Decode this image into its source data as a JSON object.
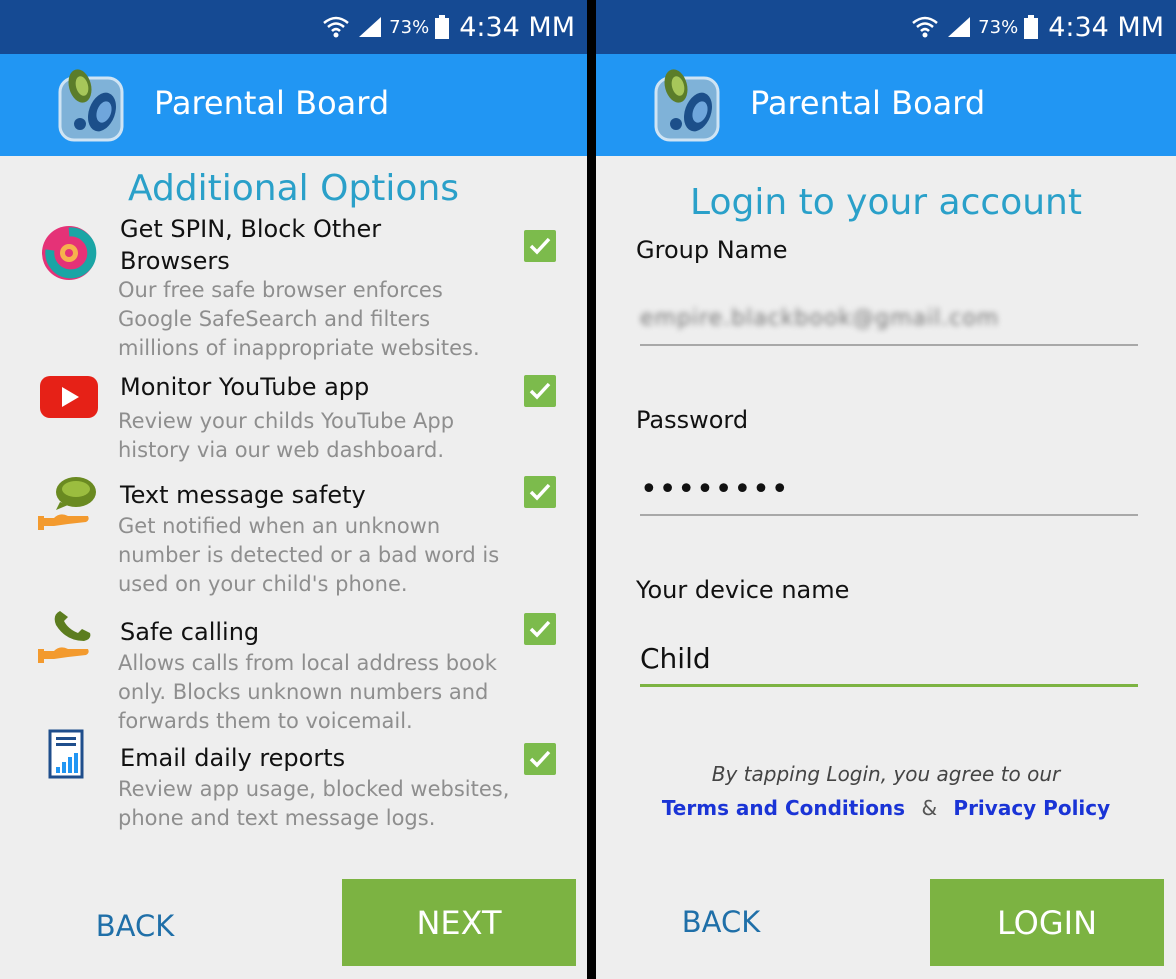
{
  "status_bar": {
    "battery": "73%",
    "time": "4:34 MM"
  },
  "app": {
    "title": "Parental Board"
  },
  "options_screen": {
    "heading": "Additional Options",
    "options": [
      {
        "title_line1": "Get SPIN, Block Other",
        "title_line2": "Browsers",
        "desc_line1": "Our free safe browser enforces",
        "desc_line2": "Google SafeSearch and filters",
        "desc_line3": "millions of inappropriate websites.",
        "icon": "spin-browser-icon",
        "checked": true
      },
      {
        "title_line1": "Monitor YouTube app",
        "desc_line1": "Review your childs YouTube App",
        "desc_line2": "history via our web dashboard.",
        "icon": "youtube-icon",
        "checked": true
      },
      {
        "title_line1": "Text message safety",
        "desc_line1": "Get notified when an unknown",
        "desc_line2": "number is detected or a bad word is",
        "desc_line3": "used on your child's phone.",
        "icon": "message-hand-icon",
        "checked": true
      },
      {
        "title_line1": "Safe calling",
        "desc_line1": "Allows calls from local address book",
        "desc_line2": "only. Blocks unknown numbers and",
        "desc_line3": "forwards them to voicemail.",
        "icon": "phone-hand-icon",
        "checked": true
      },
      {
        "title_line1": "Email daily reports",
        "desc_line1": "Review app usage, blocked websites,",
        "desc_line2": "phone and text message logs.",
        "icon": "report-icon",
        "checked": true
      }
    ],
    "back_label": "BACK",
    "next_label": "NEXT"
  },
  "login_screen": {
    "heading": "Login to your account",
    "group_label": "Group Name",
    "group_value": "empire.blackbook@gmail.com",
    "password_label": "Password",
    "password_value": "••••••••",
    "device_label": "Your device name",
    "device_value": "Child",
    "agree_text": "By tapping Login, you agree to our",
    "terms_label": "Terms and Conditions",
    "amp": "&",
    "privacy_label": "Privacy Policy",
    "back_label": "BACK",
    "login_label": "LOGIN"
  },
  "colors": {
    "status_bar": "#154a93",
    "app_bar": "#2196f3",
    "accent_green": "#7cb342",
    "heading_blue": "#2aa0c9",
    "link_blue": "#1a34d6"
  }
}
